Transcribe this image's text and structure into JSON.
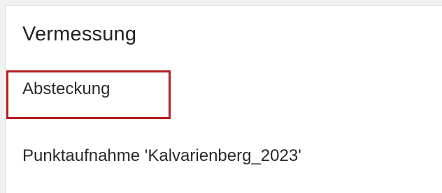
{
  "section": {
    "title": "Vermessung"
  },
  "menu": {
    "items": [
      {
        "label": "Absteckung",
        "highlighted": true
      },
      {
        "label": "Punktaufnahme 'Kalvarienberg_2023'",
        "highlighted": false
      }
    ]
  },
  "colors": {
    "background": "#f1f1f1",
    "panel": "#ffffff",
    "text": "#2a2a2a",
    "highlight_border": "#b71c1c"
  }
}
